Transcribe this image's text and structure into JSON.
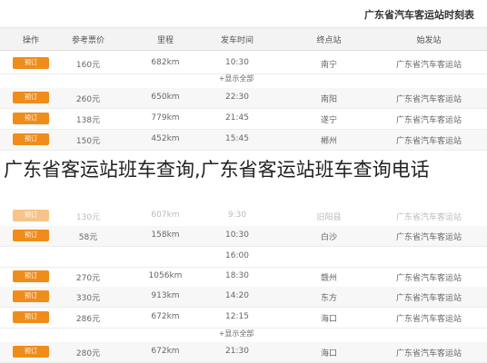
{
  "title": "广东省汽车客运站时刻表",
  "headers": [
    "操作",
    "参考票价",
    "里程",
    "发车时间",
    "终点站",
    "始发站"
  ],
  "button_label": "预订",
  "more_label": "+显示全部",
  "overlay_text": "广东省客运站班车查询,广东省客运站班车查询电话",
  "rows": [
    {
      "price": "160元",
      "distance": "682km",
      "time": "10:30",
      "end": "南宁",
      "start": "广东省汽车客运站"
    },
    {
      "price": "260元",
      "distance": "650km",
      "time": "22:30",
      "end": "南阳",
      "start": "广东省汽车客运站"
    },
    {
      "price": "138元",
      "distance": "779km",
      "time": "21:45",
      "end": "遂宁",
      "start": "广东省汽车客运站"
    },
    {
      "price": "150元",
      "distance": "452km",
      "time": "15:45",
      "end": "郴州",
      "start": "广东省汽车客运站"
    },
    {
      "price": "130元",
      "distance": "607km",
      "time": "9:30",
      "end": "旧阳县",
      "start": "广东省汽车客运站"
    },
    {
      "price": "58元",
      "distance": "158km",
      "time": "10:30",
      "end": "白沙",
      "start": "广东省汽车客运站"
    },
    {
      "price": "270元",
      "distance": "1056km",
      "time": "18:30",
      "end": "赣州",
      "start": "广东省汽车客运站"
    },
    {
      "price": "330元",
      "distance": "913km",
      "time": "14:20",
      "end": "东方",
      "start": "广东省汽车客运站"
    },
    {
      "price": "286元",
      "distance": "672km",
      "time": "12:15",
      "end": "海口",
      "start": "广东省汽车客运站"
    },
    {
      "price": "280元",
      "distance": "672km",
      "time": "21:30",
      "end": "海口",
      "start": "广东省汽车客运站"
    }
  ],
  "extra_time": "16:00",
  "colors": {
    "button": "#f08c1a",
    "header_bg": "#f3f3f3"
  }
}
